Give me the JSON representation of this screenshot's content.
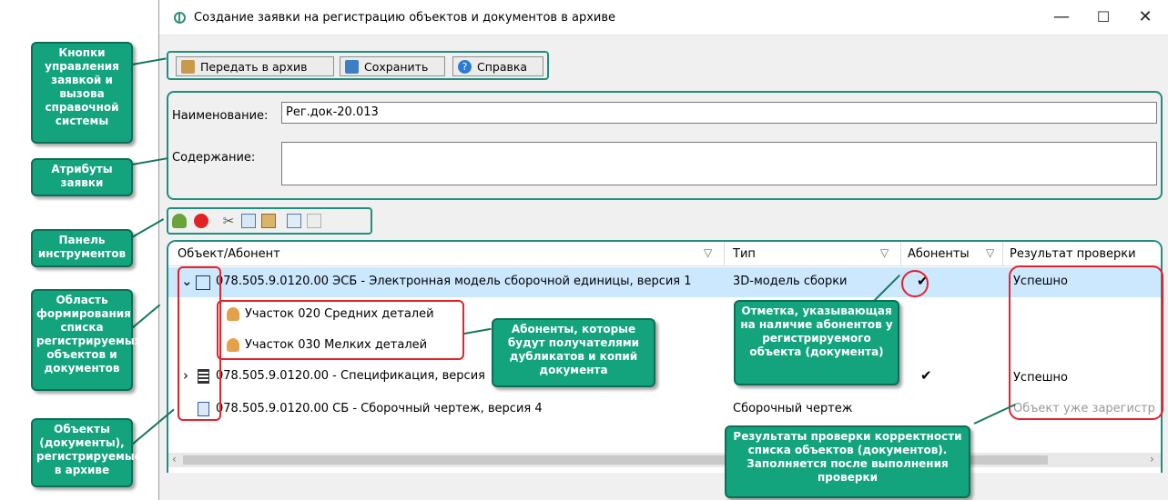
{
  "window": {
    "title": "Создание заявки на регистрацию объектов и документов в архиве",
    "controls": {
      "minimize": "—",
      "maximize": "☐",
      "close": "✕"
    }
  },
  "toolbar": {
    "send_label": "Передать в архив",
    "save_label": "Сохранить",
    "help_label": "Справка"
  },
  "attributes": {
    "name_label": "Наименование:",
    "name_value": "Рег.док-20.013",
    "content_label": "Содержание:",
    "content_value": ""
  },
  "grid": {
    "columns": [
      "Объект/Абонент",
      "Тип",
      "Абоненты",
      "Результат проверки"
    ],
    "rows": [
      {
        "expander": "⌄",
        "object": "078.505.9.0120.00 ЭСБ - Электронная модель сборочной единицы, версия 1",
        "type": "3D-модель сборки",
        "subscribers": "✔",
        "result": "Успешно"
      },
      {
        "expander": "",
        "object": "Участок 020 Средних деталей",
        "type": "",
        "subscribers": "",
        "result": ""
      },
      {
        "expander": "",
        "object": "Участок 030 Мелких деталей",
        "type": "",
        "subscribers": "",
        "result": ""
      },
      {
        "expander": "›",
        "object": "078.505.9.0120.00 - Спецификация, версия",
        "type": "",
        "subscribers": "✔",
        "result": "Успешно"
      },
      {
        "expander": "",
        "object": "078.505.9.0120.00 СБ - Сборочный чертеж, версия 4",
        "type": "Сборочный чертеж",
        "subscribers": "",
        "result": "Объект уже зарегистр"
      }
    ],
    "scroll_left": "‹",
    "scroll_right": "›"
  },
  "callouts": {
    "buttons": "Кнопки управления заявкой и вызова справочной системы",
    "attributes": "Атрибуты заявки",
    "toolbar": "Панель инструментов",
    "area": "Область формирования списка регистрируемых объектов и документов",
    "objects": "Объекты (документы), регистрируемые в архиве",
    "subscribers": "Абоненты, которые будут получателями дубликатов и копий документа",
    "mark": "Отметка, указывающая на наличие абонентов у регистрируемого объекта (документа)",
    "results": "Результаты проверки корректности списка объектов (документов). Заполняется после выполнения проверки"
  },
  "colors": {
    "accent": "#13a37d",
    "frame": "#1f8f80",
    "highlight": "#cce8ff",
    "annotation": "#e8212b"
  }
}
